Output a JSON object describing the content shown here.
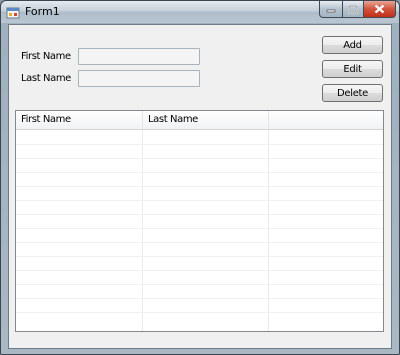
{
  "window": {
    "title": "Form1",
    "app_icon": "winforms-app-icon",
    "caption_buttons": [
      {
        "name": "minimize",
        "icon": "minimize-icon"
      },
      {
        "name": "maximize",
        "icon": "maximize-icon"
      },
      {
        "name": "close",
        "icon": "close-icon"
      }
    ]
  },
  "form": {
    "first_name_label": "First Name",
    "first_name_value": "",
    "last_name_label": "Last Name",
    "last_name_value": ""
  },
  "buttons": {
    "add": "Add",
    "edit": "Edit",
    "delete": "Delete"
  },
  "grid": {
    "columns": [
      "First Name",
      "Last Name",
      ""
    ],
    "rows": []
  },
  "colors": {
    "close_button": "#c8432b",
    "client_background": "#f0f0f0"
  }
}
